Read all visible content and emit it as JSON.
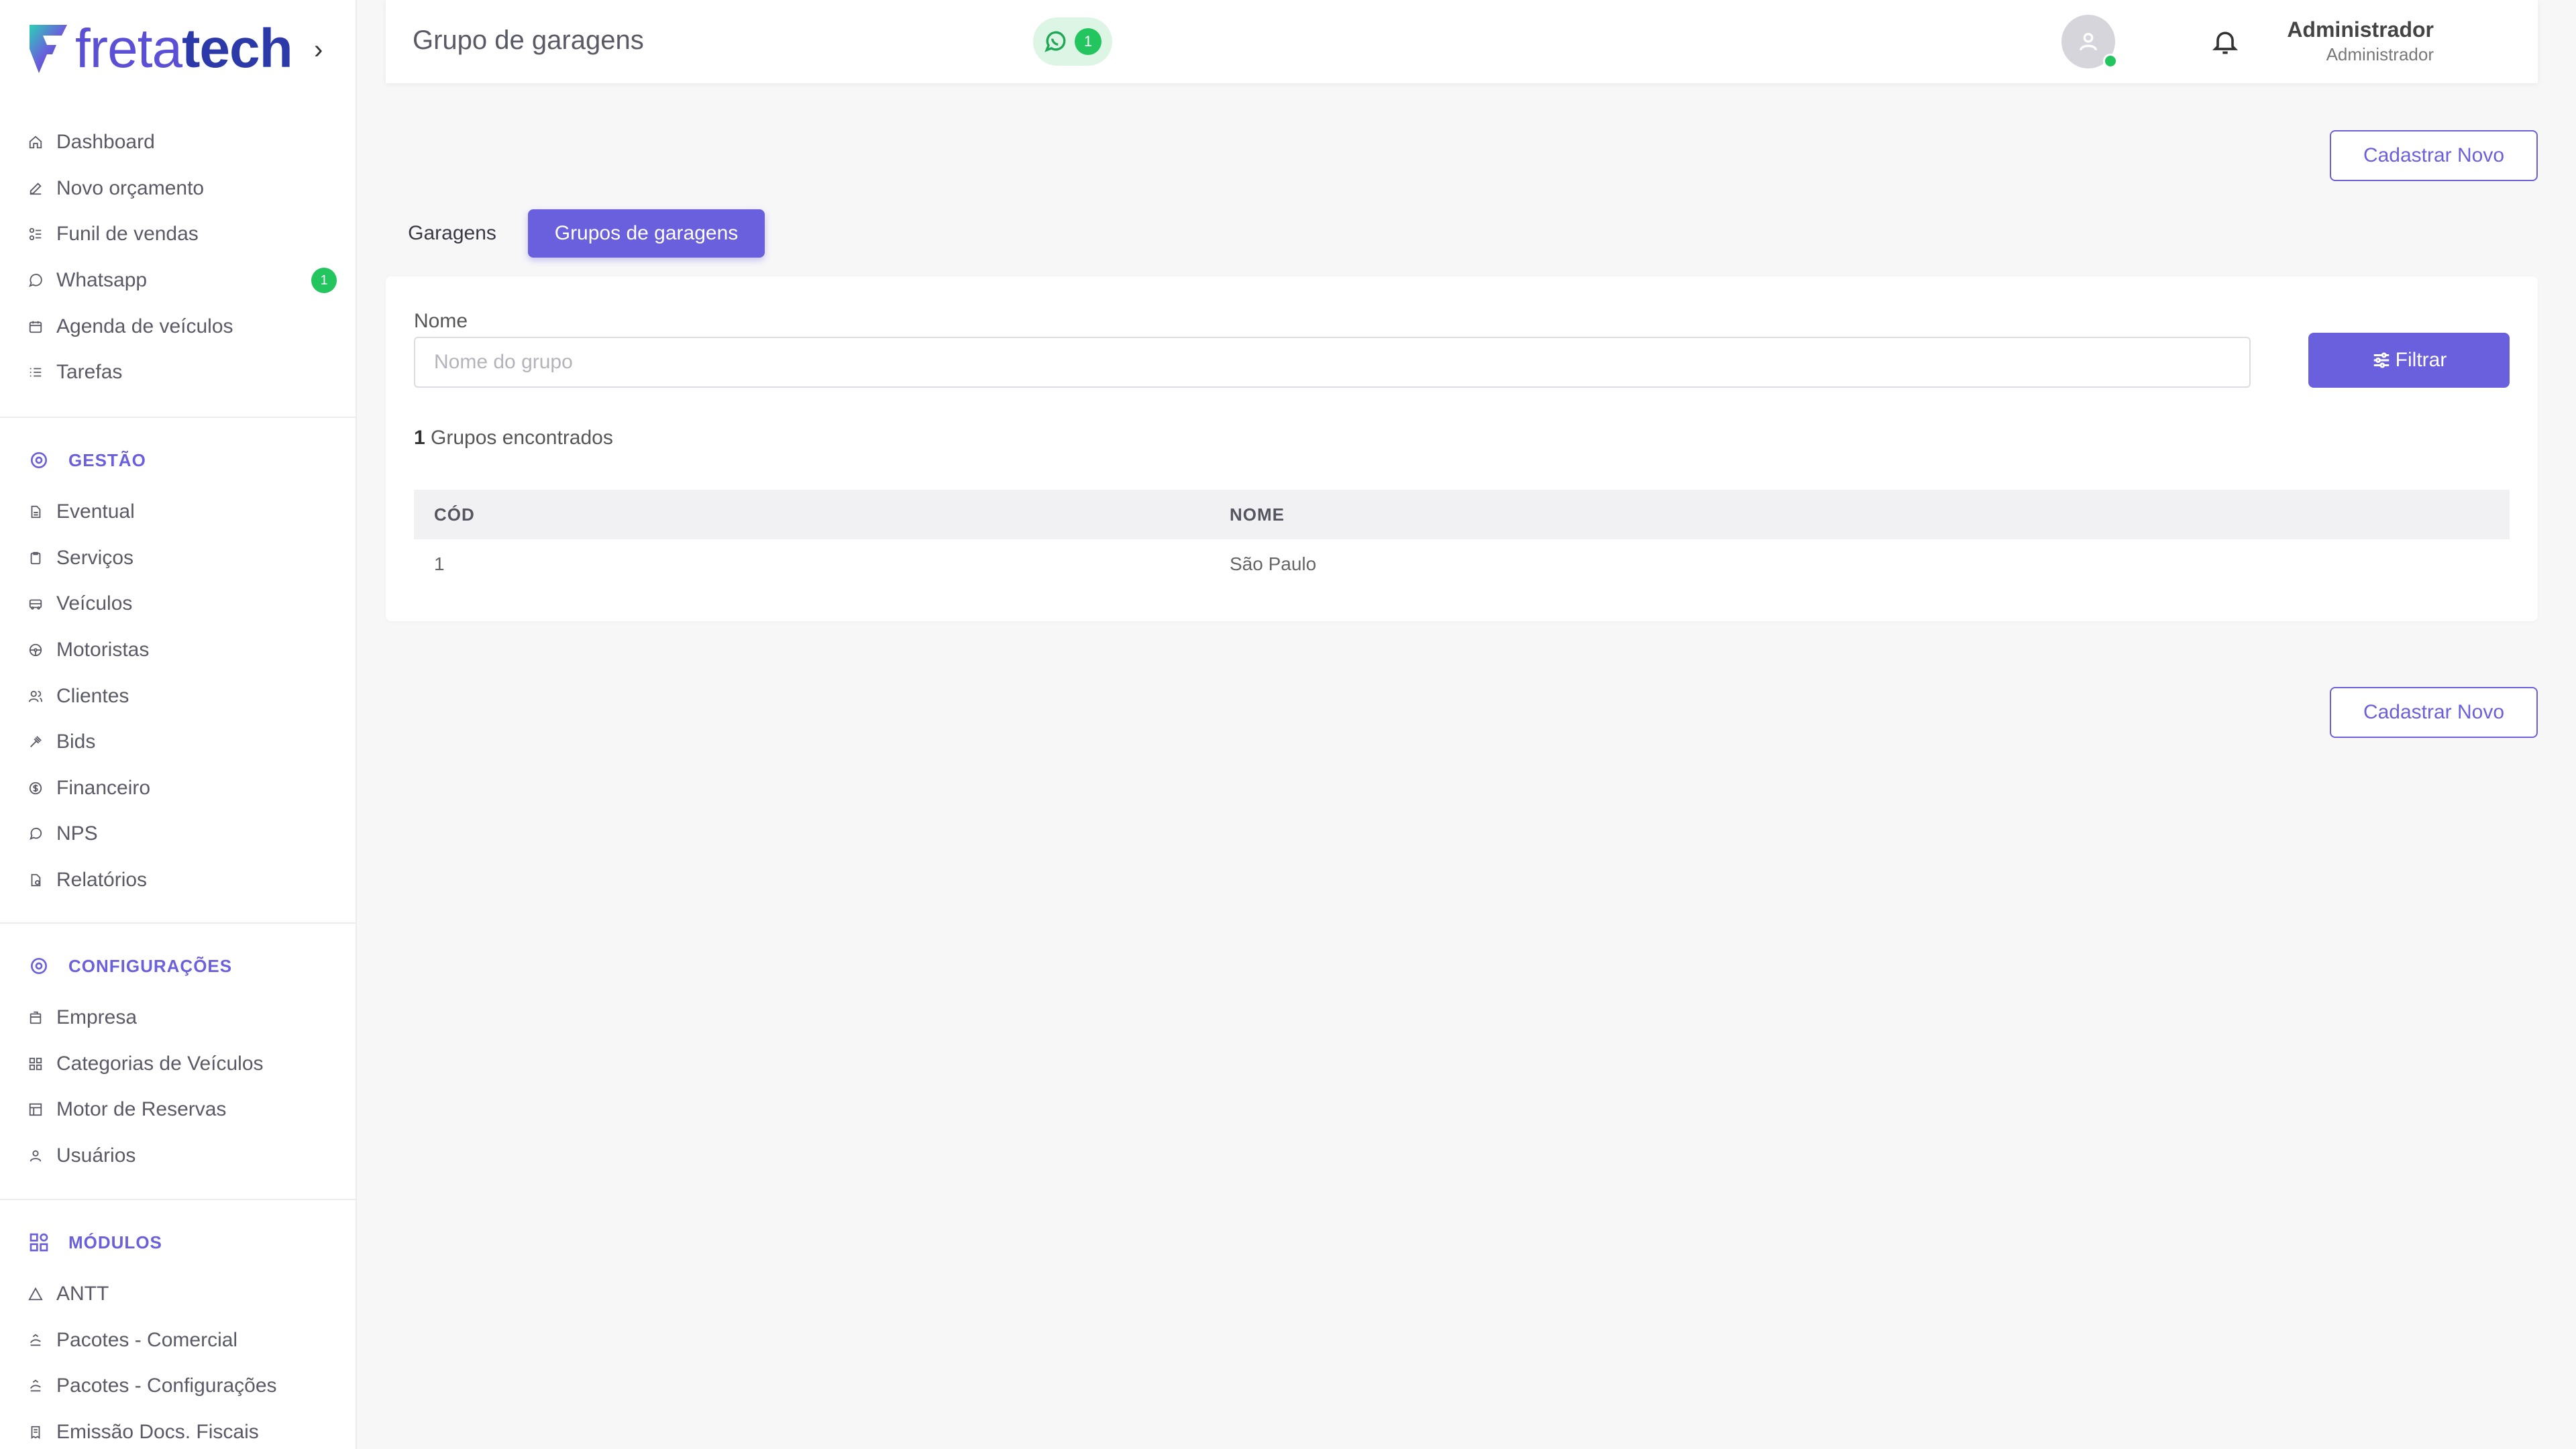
{
  "brand": {
    "part1": "freta",
    "part2": "tech",
    "caret": "›"
  },
  "header": {
    "title": "Grupo de garagens",
    "whatsapp_count": "1",
    "user_name": "Administrador",
    "user_role": "Administrador"
  },
  "sidebar": {
    "main": [
      {
        "label": "Dashboard",
        "icon": "home-icon"
      },
      {
        "label": "Novo orçamento",
        "icon": "edit-icon"
      },
      {
        "label": "Funil de vendas",
        "icon": "funnel-icon"
      },
      {
        "label": "Whatsapp",
        "icon": "whatsapp-icon",
        "badge": "1"
      },
      {
        "label": "Agenda de veículos",
        "icon": "calendar-icon"
      },
      {
        "label": "Tarefas",
        "icon": "list-icon"
      }
    ],
    "sections": [
      {
        "title": "GESTÃO",
        "items": [
          {
            "label": "Eventual",
            "icon": "document-icon"
          },
          {
            "label": "Serviços",
            "icon": "clipboard-icon"
          },
          {
            "label": "Veículos",
            "icon": "bus-icon"
          },
          {
            "label": "Motoristas",
            "icon": "steering-wheel-icon"
          },
          {
            "label": "Clientes",
            "icon": "users-icon"
          },
          {
            "label": "Bids",
            "icon": "gavel-icon"
          },
          {
            "label": "Financeiro",
            "icon": "dollar-icon"
          },
          {
            "label": "NPS",
            "icon": "chat-icon"
          },
          {
            "label": "Relatórios",
            "icon": "report-icon"
          }
        ]
      },
      {
        "title": "CONFIGURAÇÕES",
        "items": [
          {
            "label": "Empresa",
            "icon": "building-icon"
          },
          {
            "label": "Categorias de Veículos",
            "icon": "grid-icon"
          },
          {
            "label": "Motor de Reservas",
            "icon": "table-icon"
          },
          {
            "label": "Usuários",
            "icon": "user-icon"
          }
        ]
      },
      {
        "title": "MÓDULOS",
        "items": [
          {
            "label": "ANTT",
            "icon": "triangle-icon"
          },
          {
            "label": "Pacotes - Comercial",
            "icon": "package-icon"
          },
          {
            "label": "Pacotes - Configurações",
            "icon": "package-icon"
          },
          {
            "label": "Emissão Docs. Fiscais",
            "icon": "receipt-icon"
          }
        ]
      }
    ]
  },
  "actions": {
    "new_label": "Cadastrar Novo"
  },
  "tabs": [
    {
      "label": "Garagens",
      "active": false
    },
    {
      "label": "Grupos de garagens",
      "active": true
    }
  ],
  "filter": {
    "label": "Nome",
    "placeholder": "Nome do grupo",
    "value": "",
    "button_label": "Filtrar"
  },
  "results": {
    "count": "1",
    "count_text": "Grupos encontrados"
  },
  "table": {
    "headers": [
      "CÓD",
      "NOME"
    ],
    "rows": [
      [
        "1",
        "São Paulo"
      ]
    ]
  },
  "colors": {
    "accent": "#6a5fdc",
    "success": "#22c55e",
    "brand_dark": "#2b3aa8"
  }
}
